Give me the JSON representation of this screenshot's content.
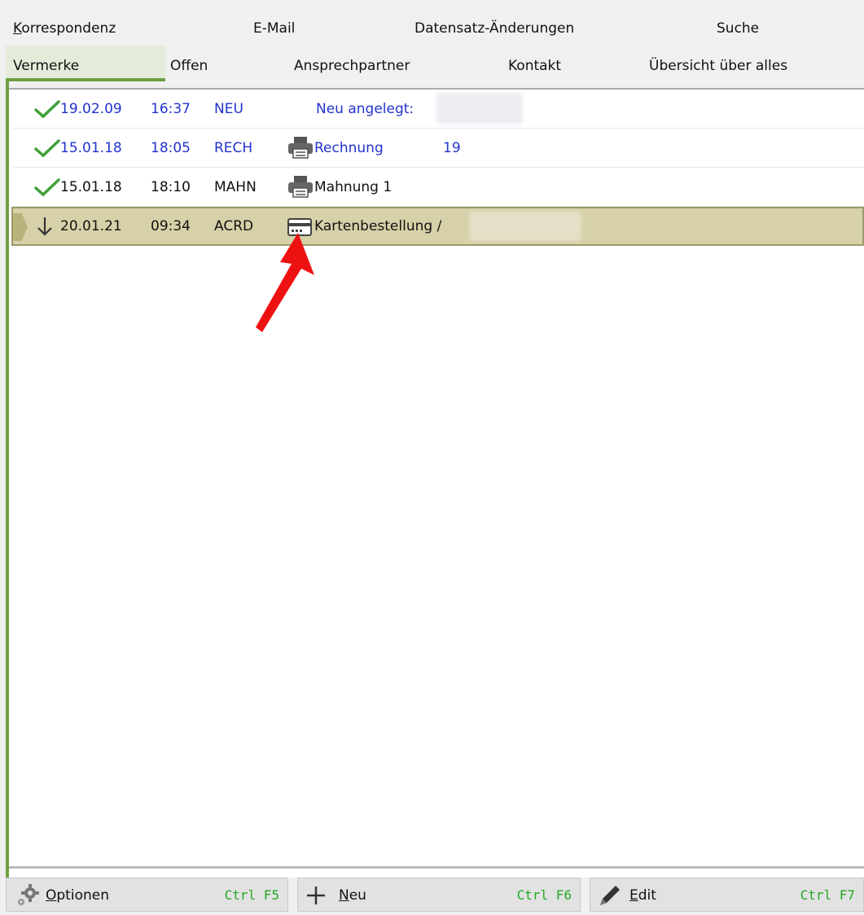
{
  "tabs_row1": [
    {
      "label": "Korrespondenz"
    },
    {
      "label": "E-Mail"
    },
    {
      "label": "Datensatz-Änderungen"
    },
    {
      "label": "Suche"
    }
  ],
  "tabs_row2": [
    {
      "label": "Vermerke",
      "active": true
    },
    {
      "label": "Offen"
    },
    {
      "label": "Ansprechpartner"
    },
    {
      "label": "Kontakt"
    },
    {
      "label": "Übersicht über alles"
    }
  ],
  "entries": [
    {
      "status_icon": "checkmark-icon",
      "date": "19.02.09",
      "time": "16:37",
      "code": "NEU",
      "type_icon": "",
      "text": "Neu angelegt:",
      "extra": ""
    },
    {
      "status_icon": "checkmark-icon",
      "date": "15.01.18",
      "time": "18:05",
      "code": "RECH",
      "type_icon": "printer-icon",
      "text": "Rechnung",
      "extra": "19"
    },
    {
      "status_icon": "checkmark-icon",
      "date": "15.01.18",
      "time": "18:10",
      "code": "MAHN",
      "type_icon": "printer-icon",
      "text": "Mahnung 1",
      "extra": ""
    },
    {
      "status_icon": "arrow-down-icon",
      "date": "20.01.21",
      "time": "09:34",
      "code": "ACRD",
      "type_icon": "card-icon",
      "text": "Kartenbestellung /",
      "extra": "",
      "selected": true
    }
  ],
  "buttons": [
    {
      "icon": "gear-icon",
      "label": "Optionen",
      "shortcut": "Ctrl F5"
    },
    {
      "icon": "plus-icon",
      "label": "Neu",
      "shortcut": "Ctrl F6"
    },
    {
      "icon": "pencil-icon",
      "label": "Edit",
      "shortcut": "Ctrl F7"
    }
  ],
  "colors": {
    "accent": "#6fa044",
    "link_blue": "#2233cc",
    "selection": "#d6d1a8",
    "shortcut": "#22aa22",
    "annotation_arrow": "#ee1111"
  }
}
